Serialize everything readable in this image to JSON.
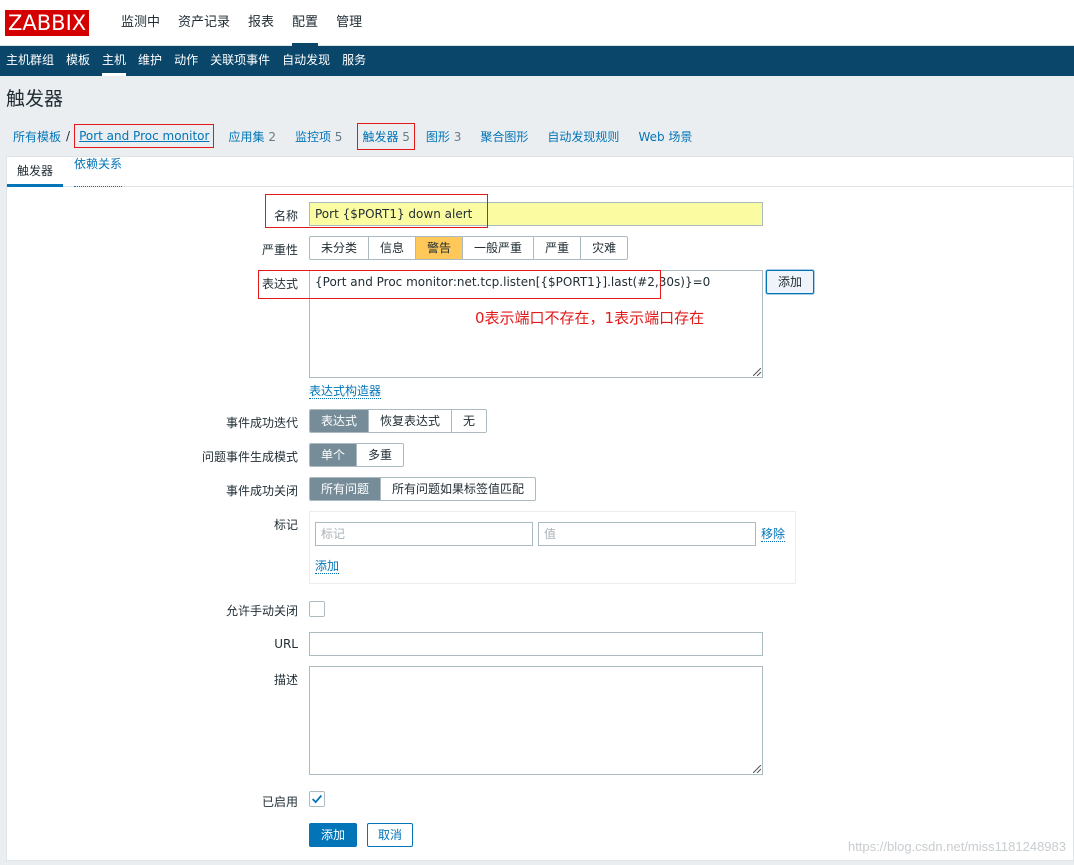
{
  "app": {
    "logo": "ZABBIX"
  },
  "topnav": [
    "监测中",
    "资产记录",
    "报表",
    "配置",
    "管理"
  ],
  "subnav": [
    "主机群组",
    "模板",
    "主机",
    "维护",
    "动作",
    "关联项事件",
    "自动发现",
    "服务"
  ],
  "page": {
    "title": "触发器"
  },
  "breadcrumbs": {
    "all_templates": "所有模板",
    "separator": "/",
    "template": "Port and Proc monitor",
    "applications": "应用集",
    "applications_count": "2",
    "items": "监控项",
    "items_count": "5",
    "triggers": "触发器",
    "triggers_count": "5",
    "graphs": "图形",
    "graphs_count": "3",
    "screens": "聚合图形",
    "discovery": "自动发现规则",
    "web": "Web 场景"
  },
  "tabs": {
    "trigger": "触发器",
    "dependencies": "依赖关系"
  },
  "form": {
    "name_label": "名称",
    "name_value": "Port {$PORT1} down alert",
    "severity_label": "严重性",
    "severity_options": [
      "未分类",
      "信息",
      "警告",
      "一般严重",
      "严重",
      "灾难"
    ],
    "severity_selected": "警告",
    "expression_label": "表达式",
    "expression_value": "{Port and Proc monitor:net.tcp.listen[{$PORT1}].last(#2,30s)}=0",
    "expression_add": "添加",
    "expression_builder": "表达式构造器",
    "ok_event_label": "事件成功迭代",
    "ok_event_options": [
      "表达式",
      "恢复表达式",
      "无"
    ],
    "problem_mode_label": "问题事件生成模式",
    "problem_mode_options": [
      "单个",
      "多重"
    ],
    "ok_close_label": "事件成功关闭",
    "ok_close_options": [
      "所有问题",
      "所有问题如果标签值匹配"
    ],
    "tags_label": "标记",
    "tag_placeholder": "标记",
    "value_placeholder": "值",
    "tag_remove": "移除",
    "tag_add": "添加",
    "manual_close_label": "允许手动关闭",
    "manual_close_checked": false,
    "url_label": "URL",
    "url_value": "",
    "description_label": "描述",
    "description_value": "",
    "enabled_label": "已启用",
    "enabled_checked": true,
    "submit": "添加",
    "cancel": "取消"
  },
  "annotation": "0表示端口不存在，1表示端口存在",
  "watermark": "https://blog.csdn.net/miss1181248983",
  "colors": {
    "accent": "#0275b8",
    "subnav_bg": "#0a466a",
    "warning": "#ffc859",
    "logo": "#d40000",
    "annotation": "#e21a1a"
  }
}
